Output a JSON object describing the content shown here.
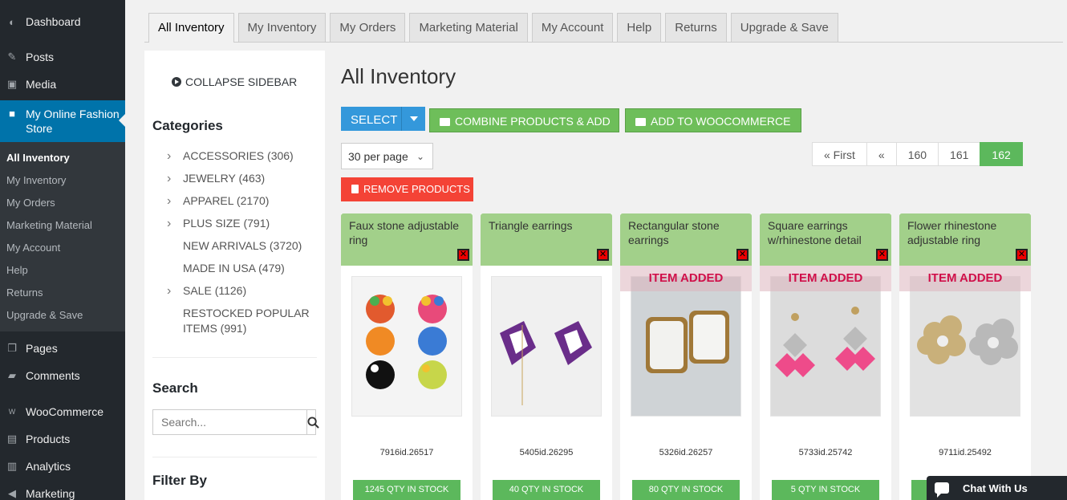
{
  "wp_menu": {
    "dashboard": "Dashboard",
    "posts": "Posts",
    "media": "Media",
    "store": "My Online Fashion Store",
    "submenu": [
      "All Inventory",
      "My Inventory",
      "My Orders",
      "Marketing Material",
      "My Account",
      "Help",
      "Returns",
      "Upgrade & Save"
    ],
    "pages": "Pages",
    "comments": "Comments",
    "woocommerce": "WooCommerce",
    "products": "Products",
    "analytics": "Analytics",
    "marketing": "Marketing"
  },
  "tabs": [
    "All Inventory",
    "My Inventory",
    "My Orders",
    "Marketing Material",
    "My Account",
    "Help",
    "Returns",
    "Upgrade & Save"
  ],
  "sidebar": {
    "collapse": "COLLAPSE SIDEBAR",
    "categories_title": "Categories",
    "categories": [
      {
        "label": "ACCESSORIES (306)",
        "expandable": true
      },
      {
        "label": "JEWELRY (463)",
        "expandable": true
      },
      {
        "label": "APPAREL (2170)",
        "expandable": true
      },
      {
        "label": "PLUS SIZE (791)",
        "expandable": true
      },
      {
        "label": "NEW ARRIVALS (3720)",
        "expandable": false
      },
      {
        "label": "MADE IN USA (479)",
        "expandable": false
      },
      {
        "label": "SALE (1126)",
        "expandable": true
      },
      {
        "label": "RESTOCKED POPULAR ITEMS (991)",
        "expandable": false
      }
    ],
    "search_title": "Search",
    "search_placeholder": "Search...",
    "filter_title": "Filter By"
  },
  "main": {
    "title": "All Inventory",
    "select_label": "SELECT",
    "combine_label": "COMBINE PRODUCTS & ADD",
    "woo_label": "ADD TO WOOCOMMERCE",
    "remove_label": "REMOVE PRODUCTS",
    "per_page": "30 per page",
    "pagination": [
      "« First",
      "«",
      "160",
      "161",
      "162"
    ],
    "current_page": "162"
  },
  "products": [
    {
      "name": "Faux stone adjustable ring",
      "id": "7916id.26517",
      "stock": "1245 QTY IN STOCK",
      "added": false
    },
    {
      "name": "Triangle earrings",
      "id": "5405id.26295",
      "stock": "40 QTY IN STOCK",
      "added": false
    },
    {
      "name": "Rectangular stone earrings",
      "id": "5326id.26257",
      "stock": "80 QTY IN STOCK",
      "added": true
    },
    {
      "name": "Square earrings w/rhinestone detail",
      "id": "5733id.25742",
      "stock": "5 QTY IN STOCK",
      "added": true
    },
    {
      "name": "Flower rhinestone adjustable ring",
      "id": "9711id.25492",
      "stock": "",
      "added": true
    }
  ],
  "item_added_label": "ITEM ADDED",
  "chat": "Chat With Us"
}
